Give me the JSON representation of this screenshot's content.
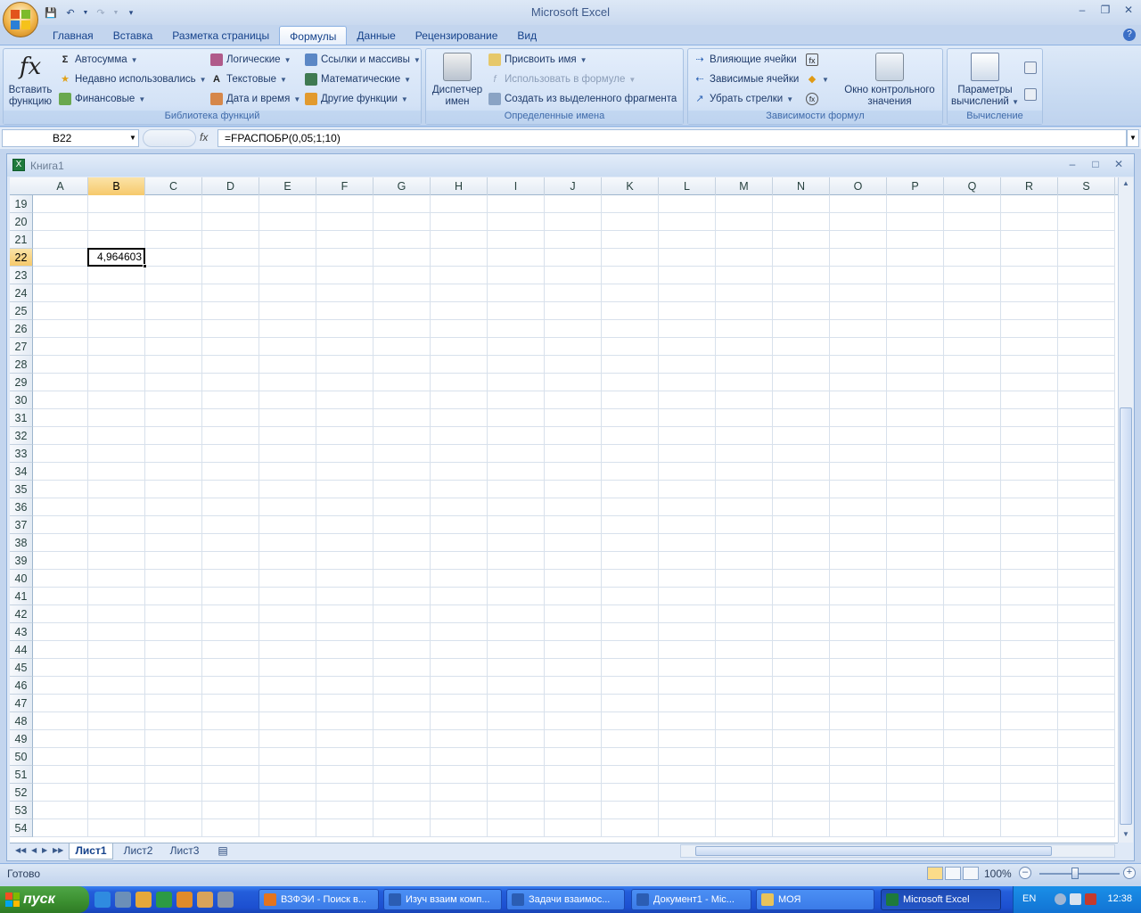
{
  "window": {
    "title": "Microsoft Excel"
  },
  "ribbon_tabs": [
    "Главная",
    "Вставка",
    "Разметка страницы",
    "Формулы",
    "Данные",
    "Рецензирование",
    "Вид"
  ],
  "active_tab": "Формулы",
  "groups": {
    "library": {
      "label": "Библиотека функций",
      "insert_function": "Вставить функцию",
      "insert_function_l1": "Вставить",
      "insert_function_l2": "функцию",
      "autosum": "Автосумма",
      "recent": "Недавно использовались",
      "financial": "Финансовые",
      "logical": "Логические",
      "text": "Текстовые",
      "datetime": "Дата и время",
      "lookup": "Ссылки и массивы",
      "math": "Математические",
      "other": "Другие функции"
    },
    "names": {
      "label": "Определенные имена",
      "manager_l1": "Диспетчер",
      "manager_l2": "имен",
      "define": "Присвоить имя",
      "use": "Использовать в формуле",
      "create": "Создать из выделенного фрагмента"
    },
    "audit": {
      "label": "Зависимости формул",
      "precedents": "Влияющие ячейки",
      "dependents": "Зависимые ячейки",
      "remove_arrows": "Убрать стрелки",
      "watch_l1": "Окно контрольного",
      "watch_l2": "значения"
    },
    "calc": {
      "label": "Вычисление",
      "options_l1": "Параметры",
      "options_l2": "вычислений"
    }
  },
  "formula_bar": {
    "name_box": "B22",
    "formula": "=FРАСПОБР(0,05;1;10)",
    "fx": "fx"
  },
  "workbook": {
    "title": "Книга1"
  },
  "grid": {
    "columns": [
      "A",
      "B",
      "C",
      "D",
      "E",
      "F",
      "G",
      "H",
      "I",
      "J",
      "K",
      "L",
      "M",
      "N",
      "O",
      "P",
      "Q",
      "R",
      "S"
    ],
    "rows": [
      "19",
      "20",
      "21",
      "22",
      "23",
      "24",
      "25",
      "26",
      "27",
      "28",
      "29",
      "30",
      "31",
      "32",
      "33",
      "34",
      "35",
      "36",
      "37",
      "38",
      "39",
      "40",
      "41",
      "42",
      "43",
      "44",
      "45",
      "46",
      "47",
      "48",
      "49",
      "50",
      "51",
      "52",
      "53",
      "54"
    ],
    "selected_col": "B",
    "selected_row": "22",
    "active_cell_value": "4,964603"
  },
  "sheets": [
    "Лист1",
    "Лист2",
    "Лист3"
  ],
  "active_sheet": "Лист1",
  "status": {
    "text": "Готово",
    "zoom": "100%"
  },
  "taskbar": {
    "start": "пуск",
    "tasks": [
      "ВЗФЭИ - Поиск в...",
      "Изуч взаим комп...",
      "Задачи взаимос...",
      "Документ1 - Mic...",
      "МОЯ",
      "Microsoft Excel"
    ],
    "active_task": "Microsoft Excel",
    "lang": "EN",
    "clock": "12:38"
  }
}
